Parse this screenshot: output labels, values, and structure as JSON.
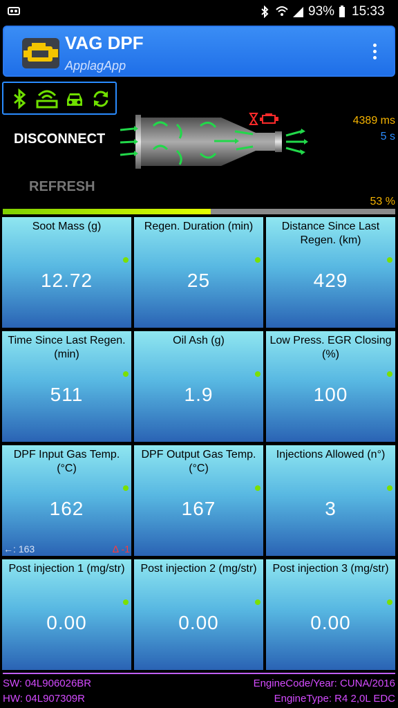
{
  "status_bar": {
    "battery": "93%",
    "time": "15:33",
    "icons": [
      "bluetooth-icon",
      "wifi-icon",
      "signal-icon",
      "battery-icon",
      "notification-icon"
    ]
  },
  "app_bar": {
    "title": "VAG DPF",
    "subtitle": "ApplagApp",
    "logo_icon": "engine-icon",
    "menu_icon": "more-vert-icon"
  },
  "toolbar_icons": [
    "bluetooth-icon",
    "adapter-icon",
    "car-icon",
    "sync-icon"
  ],
  "connection": {
    "disconnect_label": "DISCONNECT",
    "refresh_label": "REFRESH",
    "response_time": "4389 ms",
    "interval": "5 s",
    "progress_label": "53 %",
    "progress": 0.53,
    "accent_color": "#2a8cff",
    "warning_color": "#f6b400"
  },
  "tiles": [
    {
      "label": "Soot Mass (g)",
      "value": "12.72"
    },
    {
      "label": "Regen. Duration (min)",
      "value": "25"
    },
    {
      "label": "Distance Since Last Regen. (km)",
      "value": "429"
    },
    {
      "label": "Time Since Last Regen. (min)",
      "value": "511"
    },
    {
      "label": "Oil Ash (g)",
      "value": "1.9"
    },
    {
      "label": "Low Press. EGR Closing (%)",
      "value": "100"
    },
    {
      "label": "DPF Input Gas Temp. (°C)",
      "value": "162",
      "extra_left": "←: 163",
      "extra_right": "∆ -1"
    },
    {
      "label": "DPF Output Gas Temp. (°C)",
      "value": "167"
    },
    {
      "label": "Injections Allowed (n°)",
      "value": "3"
    },
    {
      "label": "Post injection 1 (mg/str)",
      "value": "0.00"
    },
    {
      "label": "Post injection 2 (mg/str)",
      "value": "0.00"
    },
    {
      "label": "Post injection 3 (mg/str)",
      "value": "0.00"
    }
  ],
  "footer": {
    "sw": "SW: 04L906026BR",
    "hw": "HW: 04L907309R",
    "engine_code": "EngineCode/Year: CUNA/2016",
    "engine_type": "EngineType: R4 2,0L EDC",
    "color": "#d44bff"
  }
}
